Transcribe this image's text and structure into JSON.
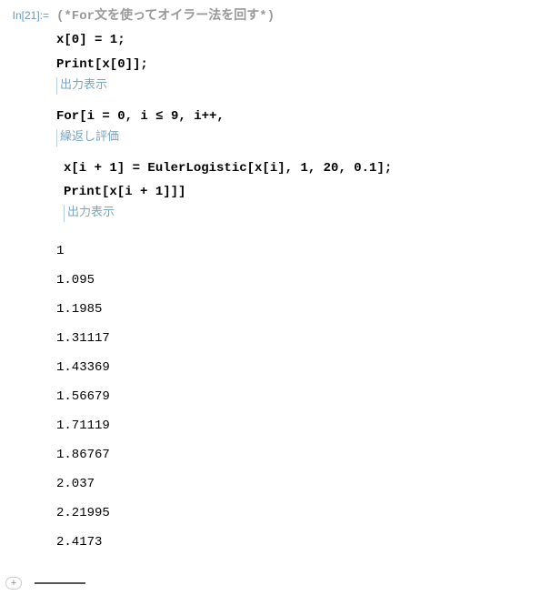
{
  "cell": {
    "in_label": "In[21]:=",
    "comment": "(*For文を使ってオイラー法を回す*)",
    "line1": "x[0] = 1;",
    "line2": "Print[x[0]];",
    "anno_print1": "出力表示",
    "line3_pre": "For[i = 0, i ",
    "line3_le": "≤",
    "line3_post": " 9, i++,",
    "anno_for": "繰返し評価",
    "line4": "x[i + 1] = EulerLogistic[x[i], 1, 20, 0.1];",
    "line5": "Print[x[i + 1]]]",
    "anno_print2": "出力表示"
  },
  "outputs": [
    "1",
    "1.095",
    "1.1985",
    "1.31117",
    "1.43369",
    "1.56679",
    "1.71119",
    "1.86767",
    "2.037",
    "2.21995",
    "2.4173"
  ],
  "add_label": "+"
}
